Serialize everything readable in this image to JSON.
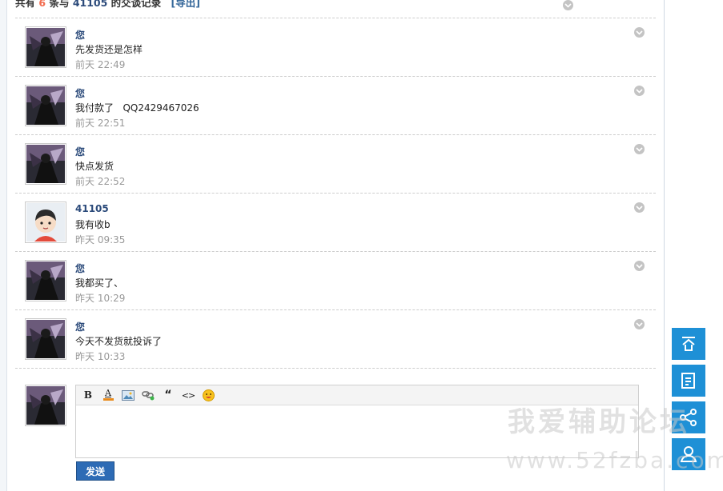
{
  "header": {
    "prefix": "共有",
    "count": "6",
    "mid": "条与",
    "partner": "41105",
    "suffix": "的交谈记录",
    "export_label": "[导出]"
  },
  "messages": [
    {
      "name": "您",
      "text": "先发货还是怎样",
      "time": "前天 22:49",
      "avatar": "dark-character-avatar"
    },
    {
      "name": "您",
      "text": "我付款了   QQ2429467026",
      "time": "前天 22:51",
      "avatar": "dark-character-avatar"
    },
    {
      "name": "您",
      "text": "快点发货",
      "time": "前天 22:52",
      "avatar": "dark-character-avatar"
    },
    {
      "name": "41105",
      "text": "我有收b",
      "time": "昨天 09:35",
      "avatar": "default-boy-avatar"
    },
    {
      "name": "您",
      "text": "我都买了、",
      "time": "昨天 10:29",
      "avatar": "dark-character-avatar"
    },
    {
      "name": "您",
      "text": "今天不发货就投诉了",
      "time": "昨天 10:33",
      "avatar": "dark-character-avatar"
    }
  ],
  "editor": {
    "toolbar": [
      "bold-icon",
      "font-color-icon",
      "image-icon",
      "link-icon",
      "quote-icon",
      "code-icon",
      "smiley-icon"
    ],
    "bold_label": "B",
    "font_color_label": "A",
    "quote_label": "“",
    "code_label": "<>",
    "text_value": "",
    "send_label": "发送"
  },
  "side_buttons": [
    "back-to-top-icon",
    "document-icon",
    "share-icon",
    "user-icon"
  ],
  "watermark": {
    "title": "我爱辅助论坛",
    "url": "www.52fzba.com"
  },
  "colors": {
    "name_blue": "#2b4a7a",
    "count_red": "#f26c4f",
    "side_button_blue": "#1e90d6",
    "send_button_blue": "#2d6bb5"
  }
}
